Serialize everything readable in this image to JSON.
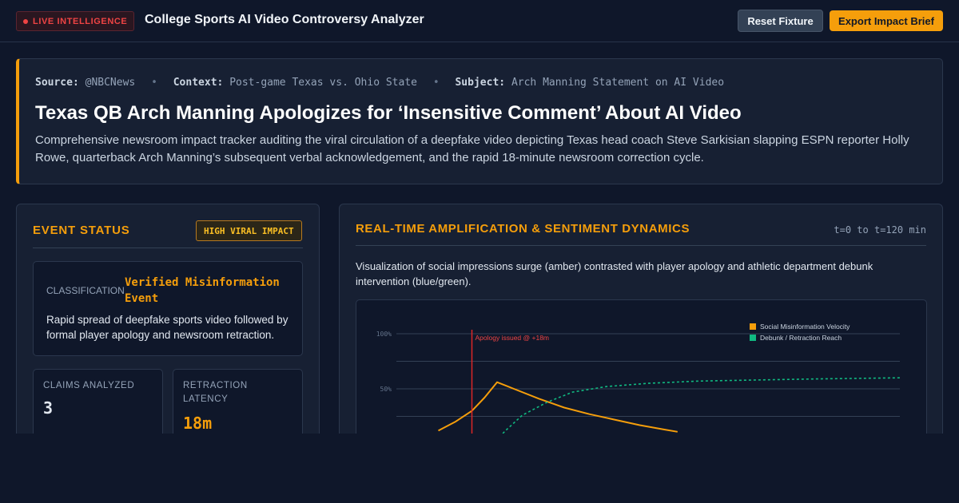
{
  "header": {
    "live_badge": "LIVE INTELLIGENCE",
    "title": "College Sports AI Video Controversy Analyzer",
    "reset_button": "Reset Fixture",
    "export_button": "Export Impact Brief"
  },
  "story": {
    "source_label": "Source:",
    "source_value": "@NBCNews",
    "context_label": "Context:",
    "context_value": "Post-game Texas vs. Ohio State",
    "subject_label": "Subject:",
    "subject_value": "Arch Manning Statement on AI Video",
    "separator": "•",
    "headline": "Texas QB Arch Manning Apologizes for ‘Insensitive Comment’ About AI Video",
    "description": "Comprehensive newsroom impact tracker auditing the viral circulation of a deepfake video depicting Texas head coach Steve Sarkisian slapping ESPN reporter Holly Rowe, quarterback Arch Manning’s subsequent verbal acknowledgement, and the rapid 18-minute newsroom correction cycle."
  },
  "event_status": {
    "title": "EVENT STATUS",
    "badge": "HIGH VIRAL IMPACT",
    "classification_label": "CLASSIFICATION",
    "classification_value": "Verified Misinformation Event",
    "classification_desc": "Rapid spread of deepfake sports video followed by formal player apology and newsroom retraction.",
    "stats": [
      {
        "label": "CLAIMS ANALYZED",
        "value": "3"
      },
      {
        "label": "RETRACTION LATENCY",
        "value": "18m"
      }
    ]
  },
  "dynamics": {
    "title": "REAL-TIME AMPLIFICATION & SENTIMENT DYNAMICS",
    "range": "t=0 to t=120 min",
    "description": "Visualization of social impressions surge (amber) contrasted with player apology and athletic department debunk intervention (blue/green)."
  },
  "chart_data": {
    "type": "line",
    "x_unit": "min",
    "xlim": [
      0,
      120
    ],
    "ylim": [
      0,
      100
    ],
    "y_ticks": [
      "100%",
      "50%"
    ],
    "grid": true,
    "legend_position": "top-right",
    "colors": {
      "velocity": "#f59e0b",
      "reach": "#10b981",
      "apology": "#dc2626"
    },
    "series": [
      {
        "name": "Social Misinformation Velocity",
        "style": "solid",
        "x": [
          10,
          14,
          18,
          21,
          24,
          28,
          34,
          40,
          46,
          52,
          58,
          64,
          67
        ],
        "y": [
          12,
          20,
          30,
          42,
          56,
          50,
          41,
          33,
          27,
          22,
          17,
          13,
          11
        ]
      },
      {
        "name": "Debunk / Retraction Reach",
        "style": "dashed",
        "x": [
          23,
          26,
          30,
          36,
          42,
          50,
          60,
          72,
          85,
          100,
          110,
          120
        ],
        "y": [
          0,
          12,
          26,
          38,
          47,
          52,
          55,
          57,
          58,
          59,
          59.5,
          60
        ]
      }
    ],
    "annotations": [
      {
        "x": 18,
        "label": "Apology issued @ +18m"
      }
    ]
  }
}
